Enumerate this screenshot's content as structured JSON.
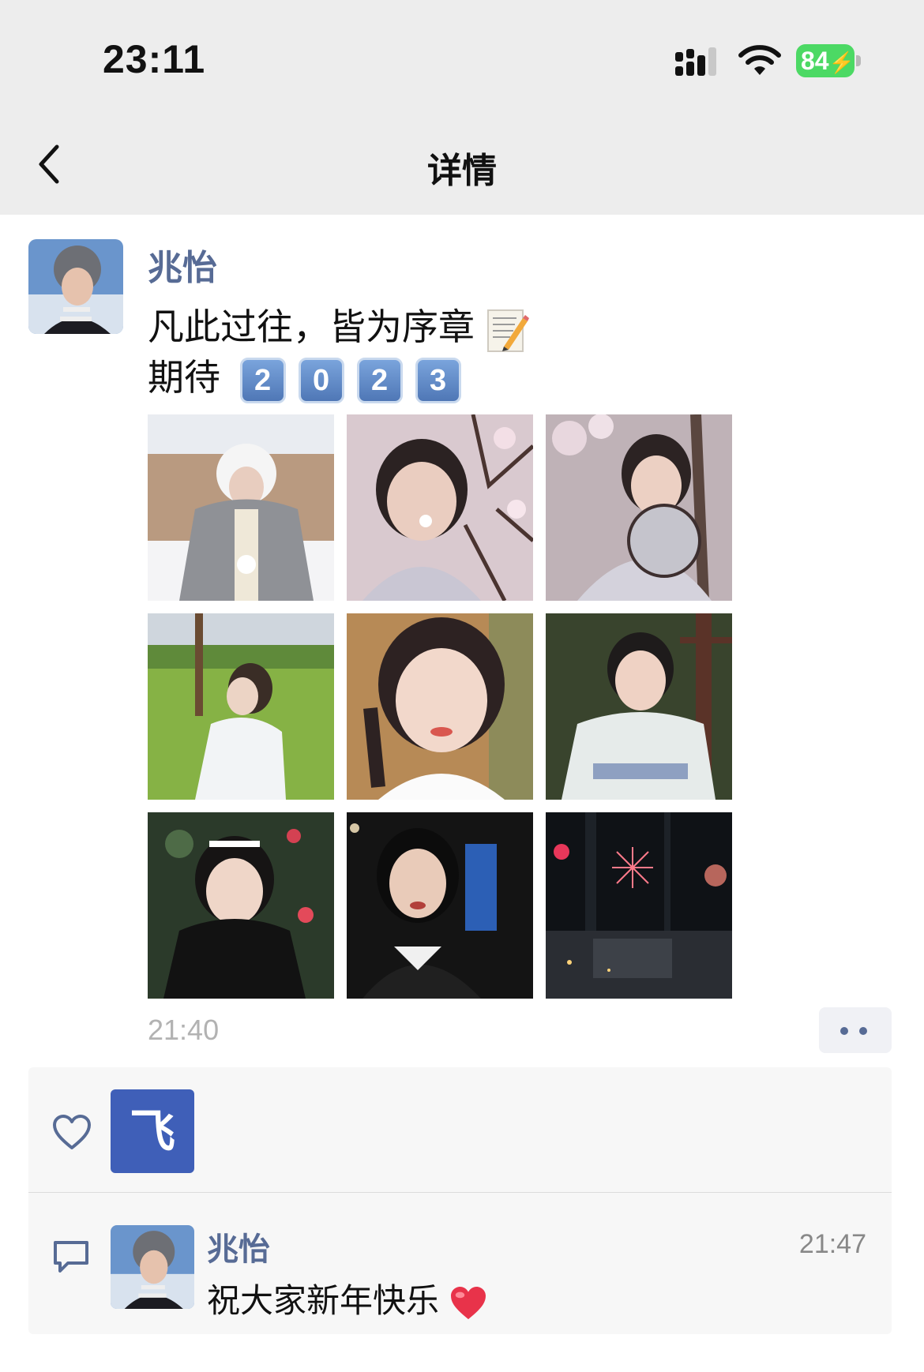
{
  "status_bar": {
    "time": "23:11",
    "battery": "84",
    "icons": [
      "signal-icon",
      "wifi-icon",
      "battery-charging-icon"
    ]
  },
  "nav": {
    "title": "详情",
    "back_icon": "chevron-left-icon"
  },
  "post": {
    "author": "兆怡",
    "line1": "凡此过往，皆为序章",
    "line1_emoji": "memo-icon",
    "line2_prefix": "期待",
    "keycap_digits": [
      "2",
      "0",
      "2",
      "3"
    ],
    "photo_count": 9,
    "time": "21:40",
    "more_icon": "more-dots-icon"
  },
  "likes": {
    "icon": "heart-outline-icon",
    "liker_avatar_text": "飞"
  },
  "comments": [
    {
      "author": "兆怡",
      "text": "祝大家新年快乐",
      "emoji": "red-heart-icon",
      "time": "21:47"
    }
  ],
  "colors": {
    "link_blue": "#576b95",
    "header_bg": "#ededed",
    "panel_bg": "#f7f7f7",
    "keycap_blue": "#5b86c4",
    "battery_green": "#4cd964"
  }
}
